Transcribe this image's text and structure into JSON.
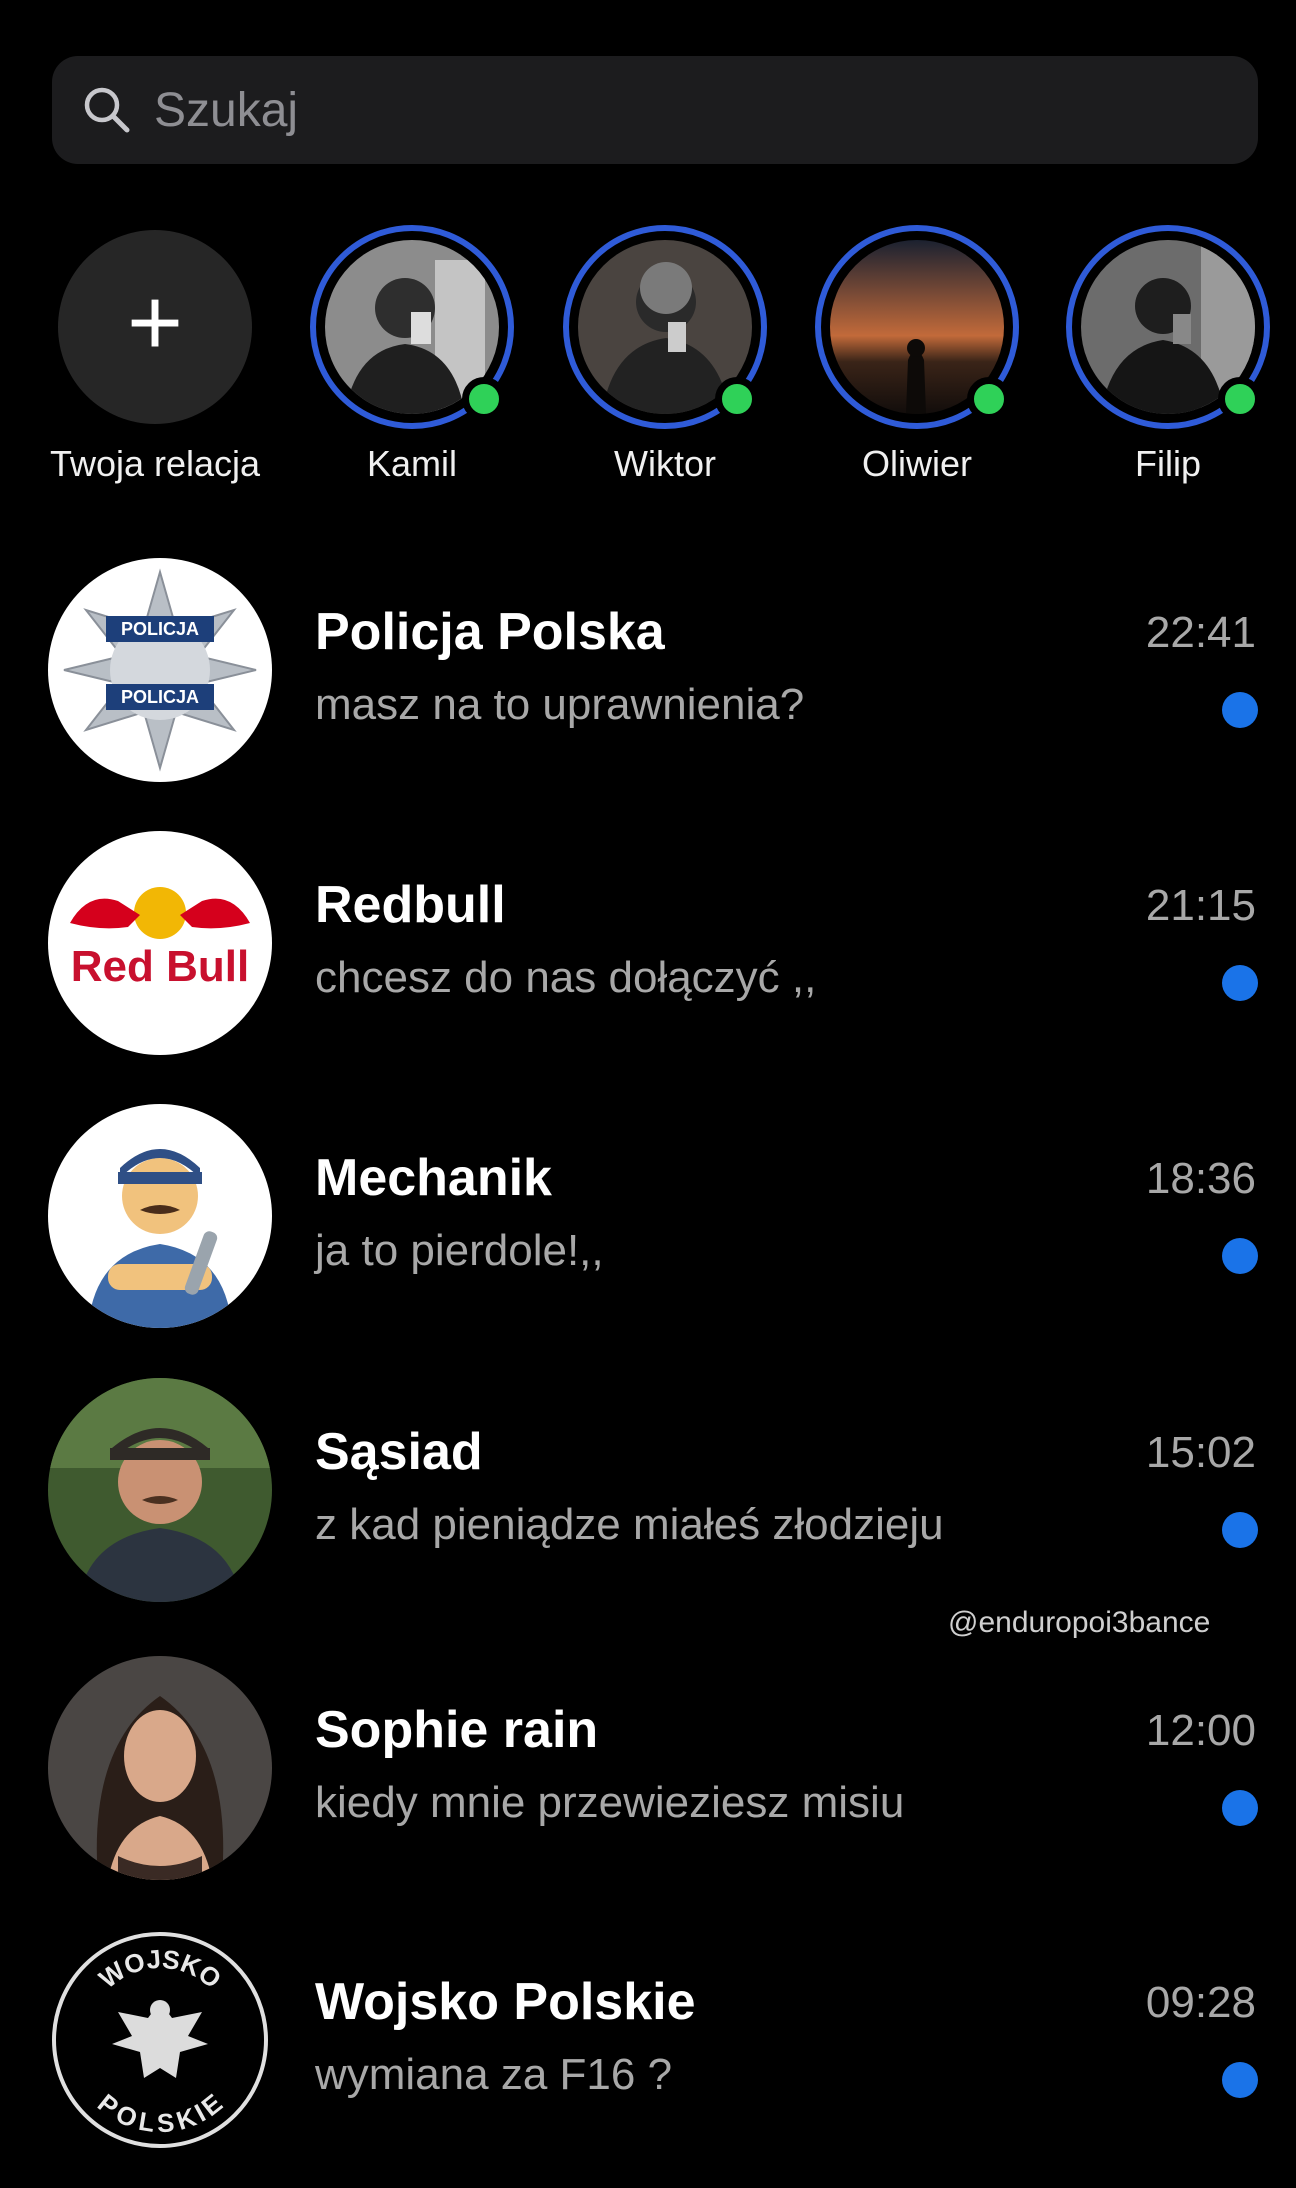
{
  "search": {
    "placeholder": "Szukaj",
    "icon": "search-icon"
  },
  "stories": {
    "add_label": "Twoja relacja",
    "items": [
      {
        "name": "Kamil",
        "online": true
      },
      {
        "name": "Wiktor",
        "online": true
      },
      {
        "name": "Oliwier",
        "online": true
      },
      {
        "name": "Filip",
        "online": true
      }
    ]
  },
  "chats": [
    {
      "name": "Policja Polska",
      "message": "masz na to uprawnienia?",
      "time": "22:41",
      "unread": true,
      "avatar_text_top": "POLICJA",
      "avatar_text_bottom": "POLICJA"
    },
    {
      "name": "Redbull",
      "message": "chcesz do nas dołączyć ,,",
      "time": "21:15",
      "unread": true,
      "avatar_text": "Red Bull"
    },
    {
      "name": "Mechanik",
      "message": "ja to pierdole!,,",
      "time": "18:36",
      "unread": true
    },
    {
      "name": "Sąsiad",
      "message": "z kad pieniądze miałeś złodzieju",
      "time": "15:02",
      "unread": true
    },
    {
      "name": "Sophie rain",
      "message": "kiedy mnie przewieziesz misiu",
      "time": "12:00",
      "unread": true
    },
    {
      "name": "Wojsko Polskie",
      "message": "wymiana za F16 ?",
      "time": "09:28",
      "unread": true,
      "avatar_text_top": "WOJSKO",
      "avatar_text_bottom": "POLSKIE"
    }
  ],
  "watermark": "@enduropoi3bance",
  "colors": {
    "story_ring": "#2f5bd8",
    "online": "#2fd158",
    "unread": "#1a73e8"
  }
}
